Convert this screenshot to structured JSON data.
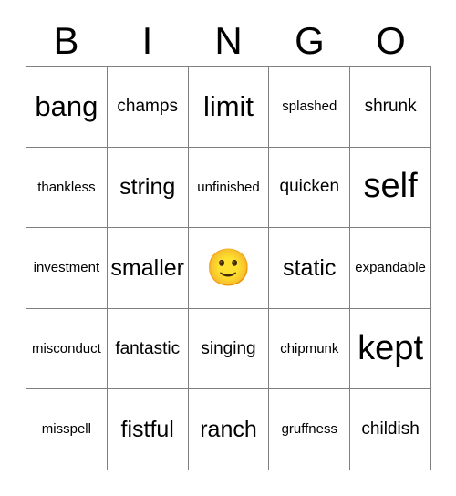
{
  "card": {
    "headers": [
      "B",
      "I",
      "N",
      "G",
      "O"
    ],
    "free_space": {
      "icon": "slightly-smiling-face-emoji",
      "glyph": "🙂"
    },
    "colors": {
      "border": "#808080",
      "text": "#000000",
      "background": "#ffffff",
      "emoji_yellow": "#fcc419"
    },
    "rows": [
      [
        {
          "text": "bang",
          "size": "lg"
        },
        {
          "text": "champs",
          "size": "sm"
        },
        {
          "text": "limit",
          "size": "lg"
        },
        {
          "text": "splashed",
          "size": "xs"
        },
        {
          "text": "shrunk",
          "size": "sm"
        }
      ],
      [
        {
          "text": "thankless",
          "size": "xs"
        },
        {
          "text": "string",
          "size": "md"
        },
        {
          "text": "unfinished",
          "size": "xs"
        },
        {
          "text": "quicken",
          "size": "sm"
        },
        {
          "text": "self",
          "size": "xl"
        }
      ],
      [
        {
          "text": "investment",
          "size": "xs"
        },
        {
          "text": "smaller",
          "size": "md"
        },
        {
          "text": "",
          "size": "free"
        },
        {
          "text": "static",
          "size": "md"
        },
        {
          "text": "expandable",
          "size": "xs"
        }
      ],
      [
        {
          "text": "misconduct",
          "size": "xs"
        },
        {
          "text": "fantastic",
          "size": "sm"
        },
        {
          "text": "singing",
          "size": "sm"
        },
        {
          "text": "chipmunk",
          "size": "xs"
        },
        {
          "text": "kept",
          "size": "xl"
        }
      ],
      [
        {
          "text": "misspell",
          "size": "xs"
        },
        {
          "text": "fistful",
          "size": "md"
        },
        {
          "text": "ranch",
          "size": "md"
        },
        {
          "text": "gruffness",
          "size": "xs"
        },
        {
          "text": "childish",
          "size": "sm"
        }
      ]
    ]
  }
}
